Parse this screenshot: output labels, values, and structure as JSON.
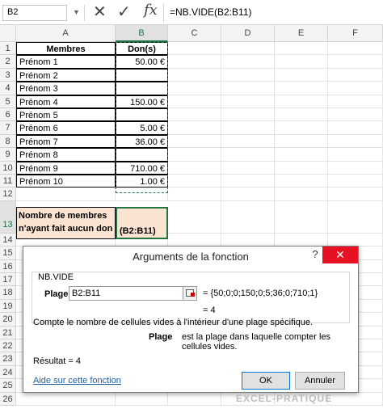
{
  "formula_bar": {
    "name_box": "B2",
    "formula": "=NB.VIDE(B2:B11)"
  },
  "columns": [
    "A",
    "B",
    "C",
    "D",
    "E",
    "F"
  ],
  "rows": [
    "1",
    "2",
    "3",
    "4",
    "5",
    "6",
    "7",
    "8",
    "9",
    "10",
    "11",
    "12",
    "13",
    "14",
    "15",
    "16",
    "17",
    "18",
    "19",
    "20",
    "21",
    "22",
    "23",
    "24",
    "25",
    "26"
  ],
  "headers": {
    "a": "Membres",
    "b": "Don(s)"
  },
  "members": [
    {
      "name": "Prénom 1",
      "don": "50.00 €"
    },
    {
      "name": "Prénom 2",
      "don": ""
    },
    {
      "name": "Prénom 3",
      "don": ""
    },
    {
      "name": "Prénom 4",
      "don": "150.00 €"
    },
    {
      "name": "Prénom 5",
      "don": ""
    },
    {
      "name": "Prénom 6",
      "don": "5.00 €"
    },
    {
      "name": "Prénom 7",
      "don": "36.00 €"
    },
    {
      "name": "Prénom 8",
      "don": ""
    },
    {
      "name": "Prénom 9",
      "don": "710.00 €"
    },
    {
      "name": "Prénom 10",
      "don": "1.00 €"
    }
  ],
  "summary": {
    "label_line1": "Nombre de membres",
    "label_line2": "n'ayant fait aucun don :",
    "formula_visible": "(B2:B11)"
  },
  "dialog": {
    "title": "Arguments de la fonction",
    "help_label": "?",
    "close_label": "✕",
    "function_name": "NB.VIDE",
    "arg_label": "Plage",
    "arg_value": "B2:B11",
    "arg_eval": "=  {50;0;0;150;0;5;36;0;710;1}",
    "result_eq": "=  4",
    "description": "Compte le nombre de cellules vides à l'intérieur d'une plage spécifique.",
    "arg_desc_label": "Plage",
    "arg_desc_text": "est la plage dans laquelle compter les cellules vides.",
    "result_text": "Résultat =   4",
    "help_link": "Aide sur cette fonction",
    "ok_label": "OK",
    "cancel_label": "Annuler"
  },
  "watermark": "EXCEL-PRATIQUE"
}
